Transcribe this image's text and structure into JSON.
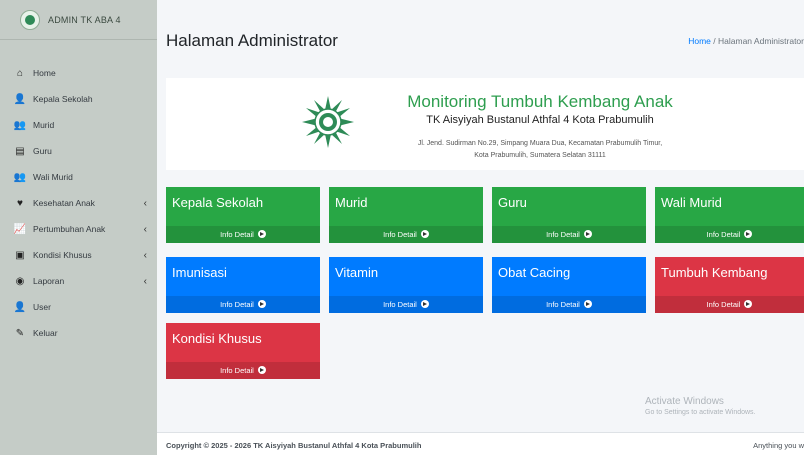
{
  "sidebar": {
    "brand": "ADMIN TK ABA 4",
    "items": [
      {
        "label": "Home",
        "icon": "home-icon",
        "glyph": "⌂",
        "chevron": false
      },
      {
        "label": "Kepala Sekolah",
        "icon": "user-tie-icon",
        "glyph": "👤",
        "chevron": false
      },
      {
        "label": "Murid",
        "icon": "users-icon",
        "glyph": "👥",
        "chevron": false
      },
      {
        "label": "Guru",
        "icon": "chalkboard-icon",
        "glyph": "▤",
        "chevron": false
      },
      {
        "label": "Wali Murid",
        "icon": "user-friends-icon",
        "glyph": "👥",
        "chevron": false
      },
      {
        "label": "Kesehatan Anak",
        "icon": "heartbeat-icon",
        "glyph": "♥",
        "chevron": true
      },
      {
        "label": "Pertumbuhan Anak",
        "icon": "chart-line-icon",
        "glyph": "📈",
        "chevron": true
      },
      {
        "label": "Kondisi Khusus",
        "icon": "clipboard-icon",
        "glyph": "▣",
        "chevron": true
      },
      {
        "label": "Laporan",
        "icon": "briefcase-icon",
        "glyph": "◉",
        "chevron": true
      },
      {
        "label": "User",
        "icon": "user-cog-icon",
        "glyph": "👤",
        "chevron": false
      },
      {
        "label": "Keluar",
        "icon": "sign-out-icon",
        "glyph": "✎",
        "chevron": false
      }
    ],
    "chevron_glyph": "‹"
  },
  "header": {
    "title": "Halaman Administrator",
    "breadcrumb_home": "Home",
    "breadcrumb_sep": "/",
    "breadcrumb_current": "Halaman Administrator"
  },
  "hero": {
    "title": "Monitoring Tumbuh Kembang Anak",
    "subtitle": "TK Aisyiyah Bustanul Athfal 4 Kota Prabumulih",
    "address_line1": "Jl. Jend. Sudirman No.29, Simpang Muara Dua, Kecamatan Prabumulih Timur,",
    "address_line2": "Kota Prabumulih, Sumatera Selatan 31111"
  },
  "cards": [
    {
      "title": "Kepala Sekolah",
      "link": "Info Detail",
      "color": "green"
    },
    {
      "title": "Murid",
      "link": "Info Detail",
      "color": "green"
    },
    {
      "title": "Guru",
      "link": "Info Detail",
      "color": "green"
    },
    {
      "title": "Wali Murid",
      "link": "Info Detail",
      "color": "green"
    },
    {
      "title": "Imunisasi",
      "link": "Info Detail",
      "color": "blue"
    },
    {
      "title": "Vitamin",
      "link": "Info Detail",
      "color": "blue"
    },
    {
      "title": "Obat Cacing",
      "link": "Info Detail",
      "color": "blue"
    },
    {
      "title": "Tumbuh Kembang",
      "link": "Info Detail",
      "color": "red"
    },
    {
      "title": "Kondisi Khusus",
      "link": "Info Detail",
      "color": "red"
    }
  ],
  "colors": {
    "green": "#28a745",
    "blue": "#007bff",
    "red": "#dc3545",
    "sidebar": "#c5ccc7"
  },
  "watermark": {
    "line1": "Activate Windows",
    "line2": "Go to Settings to activate Windows."
  },
  "footer": {
    "copyright": "Copyright © 2025 - 2026 TK Aisyiyah Bustanul Athfal 4 Kota Prabumulih",
    "right": "Anything you w"
  }
}
